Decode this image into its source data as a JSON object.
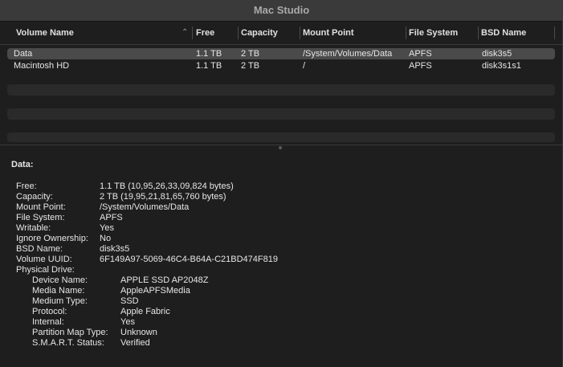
{
  "window": {
    "title": "Mac Studio"
  },
  "table": {
    "columns": [
      "Volume Name",
      "Free",
      "Capacity",
      "Mount Point",
      "File System",
      "BSD Name"
    ],
    "sort_icon": "chevron-up-icon",
    "rows": [
      {
        "name": "Data",
        "free": "1.1 TB",
        "capacity": "2 TB",
        "mount": "/System/Volumes/Data",
        "fs": "APFS",
        "bsd": "disk3s5",
        "selected": true
      },
      {
        "name": "Macintosh HD",
        "free": "1.1 TB",
        "capacity": "2 TB",
        "mount": "/",
        "fs": "APFS",
        "bsd": "disk3s1s1",
        "selected": false
      }
    ]
  },
  "detail": {
    "title": "Data:",
    "fields": [
      {
        "label": "Free:",
        "value": "1.1 TB (10,95,26,33,09,824 bytes)"
      },
      {
        "label": "Capacity:",
        "value": "2 TB (19,95,21,81,65,760 bytes)"
      },
      {
        "label": "Mount Point:",
        "value": "/System/Volumes/Data"
      },
      {
        "label": "File System:",
        "value": "APFS"
      },
      {
        "label": "Writable:",
        "value": "Yes"
      },
      {
        "label": "Ignore Ownership:",
        "value": "No"
      },
      {
        "label": "BSD Name:",
        "value": "disk3s5"
      },
      {
        "label": "Volume UUID:",
        "value": "6F149A97-5069-46C4-B64A-C21BD474F819"
      },
      {
        "label": "Physical Drive:",
        "value": ""
      }
    ],
    "drive_fields": [
      {
        "label": "Device Name:",
        "value": "APPLE SSD AP2048Z"
      },
      {
        "label": "Media Name:",
        "value": "AppleAPFSMedia"
      },
      {
        "label": "Medium Type:",
        "value": "SSD"
      },
      {
        "label": "Protocol:",
        "value": "Apple Fabric"
      },
      {
        "label": "Internal:",
        "value": "Yes"
      },
      {
        "label": "Partition Map Type:",
        "value": "Unknown"
      },
      {
        "label": "S.M.A.R.T. Status:",
        "value": "Verified"
      }
    ]
  }
}
